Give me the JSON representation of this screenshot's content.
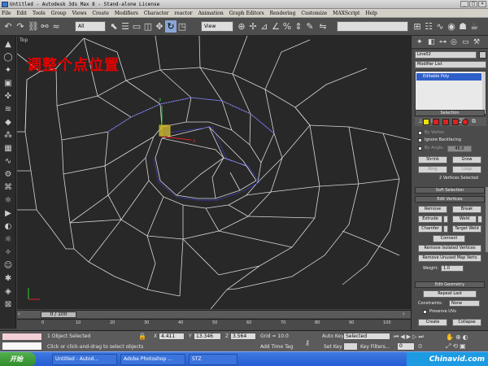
{
  "window": {
    "title": "Untitled - Autodesk 3ds Max 8 - Stand-alone License",
    "controls": [
      "_",
      "□",
      "×"
    ]
  },
  "menu": [
    "File",
    "Edit",
    "Tools",
    "Group",
    "Views",
    "Create",
    "Modifiers",
    "Character",
    "reactor",
    "Animation",
    "Graph Editors",
    "Rendering",
    "Customize",
    "MAXScript",
    "Help"
  ],
  "toolbar": {
    "selection_filter": "All",
    "ref_coord": "View",
    "named_selection": ""
  },
  "viewport": {
    "label": "Top",
    "caption": "调整个点位置"
  },
  "timeslider": {
    "value": "0 / 100"
  },
  "ruler": {
    "ticks": [
      "0",
      "10",
      "20",
      "30",
      "40",
      "50",
      "60",
      "70",
      "80",
      "90",
      "100"
    ]
  },
  "status": {
    "selection_count": "1 Object Selected",
    "prompt": "Click or click-and-drag to select objects",
    "x_label": "X",
    "x_value": "4.411",
    "y_label": "Y",
    "y_value": "13.346",
    "z_label": "Z",
    "z_value": "3.564",
    "grid": "Grid = 10.0",
    "add_time_tag": "Add Time Tag",
    "auto_key": "Auto Key",
    "auto_key_mode": "Selected",
    "set_key": "Set Key",
    "key_filters": "Key Filters...",
    "frame": "0"
  },
  "panel": {
    "object_name": "Line02",
    "modifier_list": "Modifier List",
    "stack_item": "Editable Poly",
    "selection_title": "Selection",
    "by_vertex": "By Vertex",
    "ignore_backfacing": "Ignore Backfacing",
    "by_angle": "By Angle:",
    "angle_value": "45.0",
    "shrink": "Shrink",
    "grow": "Grow",
    "ring": "Ring",
    "loop": "Loop",
    "selected_info": "2 Vertices Selected",
    "soft_selection": "Soft Selection",
    "edit_vertices": "Edit Vertices",
    "remove": "Remove",
    "break": "Break",
    "extrude": "Extrude",
    "weld": "Weld",
    "chamfer": "Chamfer",
    "target_weld": "Target Weld",
    "connect": "Connect",
    "remove_isolated": "Remove Isolated Vertices",
    "remove_unused": "Remove Unused Map Verts",
    "weight_label": "Weight:",
    "weight_value": "1.0",
    "edit_geometry": "Edit Geometry",
    "repeat_last": "Repeat Last",
    "constraints_label": "Constraints:",
    "constraints_value": "None",
    "preserve_uvs": "Preserve UVs",
    "create": "Create",
    "collapse": "Collapse"
  },
  "taskbar": {
    "start": "开始",
    "items": [
      "Untitled - Autod...",
      "Adobe Photoshop ...",
      "STZ"
    ],
    "watermark": "Chinavid.com"
  },
  "colors": {
    "viewport_bg": "#282828",
    "wire": "#d8d8d8",
    "selected_wire": "#3a3ad8",
    "caption": "#e60000",
    "active_stack": "#2f5fc8"
  }
}
